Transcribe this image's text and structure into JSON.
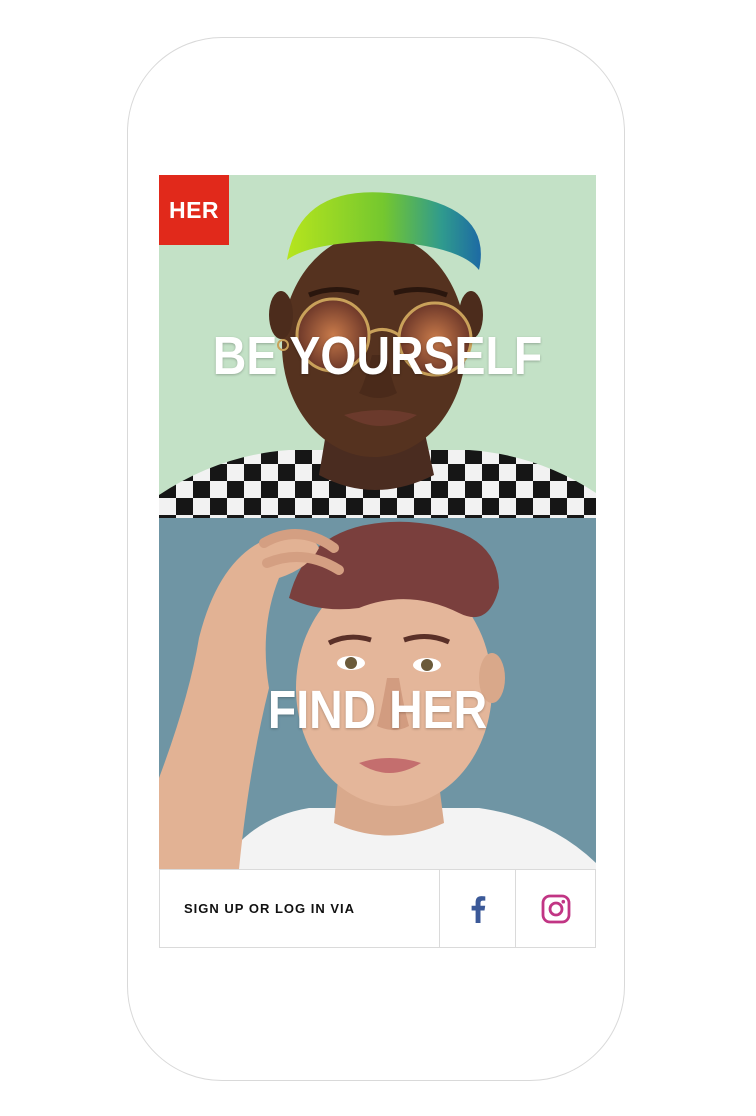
{
  "logo": {
    "text": "HER",
    "color": "#e1291b"
  },
  "panels": [
    {
      "headline": "BE YOURSELF",
      "background": "#c3e1c6"
    },
    {
      "headline": "FIND HER",
      "background": "#6f95a4"
    }
  ],
  "footer": {
    "signup_label": "SIGN UP OR LOG IN VIA",
    "facebook_icon": "facebook-icon",
    "instagram_icon": "instagram-icon",
    "facebook_color": "#3b5998",
    "instagram_color": "#c13584"
  }
}
